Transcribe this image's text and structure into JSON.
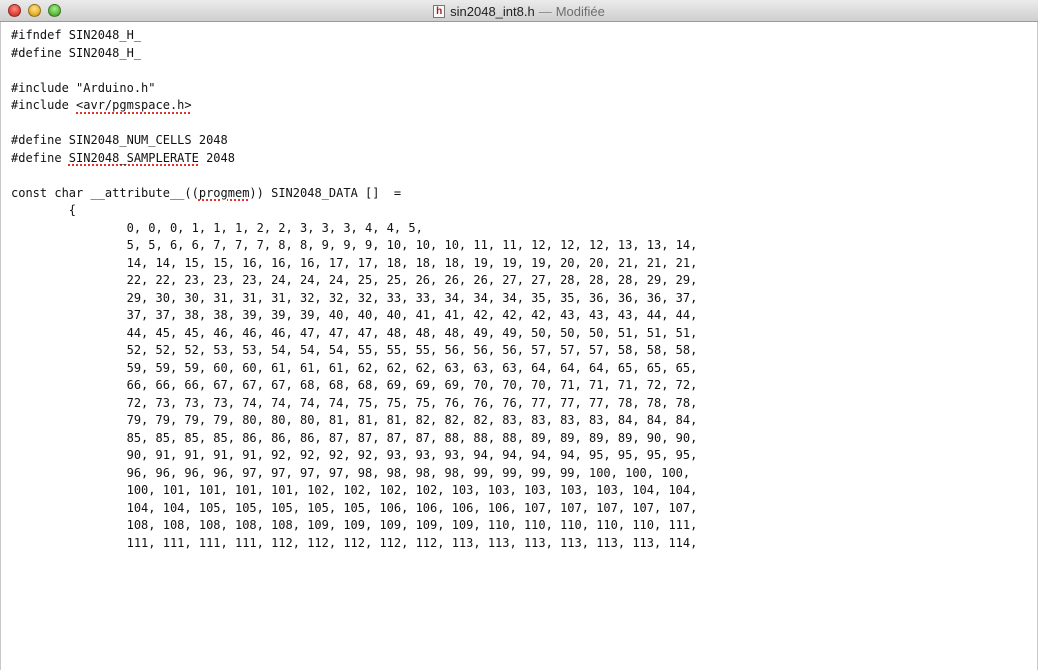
{
  "window": {
    "icon_letter": "h",
    "filename": "sin2048_int8.h",
    "separator": "—",
    "status": "Modifiée"
  },
  "code": {
    "header": [
      [
        {
          "t": "#ifndef SIN2048_H_"
        }
      ],
      [
        {
          "t": "#define SIN2048_H_"
        }
      ],
      [
        {
          "t": ""
        }
      ],
      [
        {
          "t": "#include \"Arduino.h\""
        }
      ],
      [
        {
          "t": "#include "
        },
        {
          "t": "<avr/pgmspace.h>",
          "spell": true
        }
      ],
      [
        {
          "t": ""
        }
      ],
      [
        {
          "t": "#define SIN2048_NUM_CELLS 2048"
        }
      ],
      [
        {
          "t": "#define "
        },
        {
          "t": "SIN2048_SAMPLERATE",
          "spell": true
        },
        {
          "t": " 2048"
        }
      ],
      [
        {
          "t": ""
        }
      ],
      [
        {
          "t": "const char __attribute__(("
        },
        {
          "t": "progmem",
          "spell": true
        },
        {
          "t": ")) SIN2048_DATA []  ="
        }
      ],
      [
        {
          "t": "        {"
        }
      ]
    ],
    "data_indent": "                ",
    "data_rows": [
      "0, 0, 0, 1, 1, 1, 2, 2, 3, 3, 3, 4, 4, 5,",
      "5, 5, 6, 6, 7, 7, 7, 8, 8, 9, 9, 9, 10, 10, 10, 11, 11, 12, 12, 12, 13, 13, 14,",
      "14, 14, 15, 15, 16, 16, 16, 17, 17, 18, 18, 18, 19, 19, 19, 20, 20, 21, 21, 21,",
      "22, 22, 23, 23, 23, 24, 24, 24, 25, 25, 26, 26, 26, 27, 27, 28, 28, 28, 29, 29,",
      "29, 30, 30, 31, 31, 31, 32, 32, 32, 33, 33, 34, 34, 34, 35, 35, 36, 36, 36, 37,",
      "37, 37, 38, 38, 39, 39, 39, 40, 40, 40, 41, 41, 42, 42, 42, 43, 43, 43, 44, 44,",
      "44, 45, 45, 46, 46, 46, 47, 47, 47, 48, 48, 48, 49, 49, 50, 50, 50, 51, 51, 51,",
      "52, 52, 52, 53, 53, 54, 54, 54, 55, 55, 55, 56, 56, 56, 57, 57, 57, 58, 58, 58,",
      "59, 59, 59, 60, 60, 61, 61, 61, 62, 62, 62, 63, 63, 63, 64, 64, 64, 65, 65, 65,",
      "66, 66, 66, 67, 67, 67, 68, 68, 68, 69, 69, 69, 70, 70, 70, 71, 71, 71, 72, 72,",
      "72, 73, 73, 73, 74, 74, 74, 74, 75, 75, 75, 76, 76, 76, 77, 77, 77, 78, 78, 78,",
      "79, 79, 79, 79, 80, 80, 80, 81, 81, 81, 82, 82, 82, 83, 83, 83, 83, 84, 84, 84,",
      "85, 85, 85, 85, 86, 86, 86, 87, 87, 87, 87, 88, 88, 88, 89, 89, 89, 89, 90, 90,",
      "90, 91, 91, 91, 91, 92, 92, 92, 92, 93, 93, 93, 94, 94, 94, 94, 95, 95, 95, 95,",
      "96, 96, 96, 96, 97, 97, 97, 97, 98, 98, 98, 98, 99, 99, 99, 99, 100, 100, 100,",
      "100, 101, 101, 101, 101, 102, 102, 102, 102, 103, 103, 103, 103, 103, 104, 104,",
      "104, 104, 105, 105, 105, 105, 105, 106, 106, 106, 106, 107, 107, 107, 107, 107,",
      "108, 108, 108, 108, 108, 109, 109, 109, 109, 109, 110, 110, 110, 110, 110, 111,",
      "111, 111, 111, 111, 112, 112, 112, 112, 112, 113, 113, 113, 113, 113, 113, 114,"
    ]
  }
}
